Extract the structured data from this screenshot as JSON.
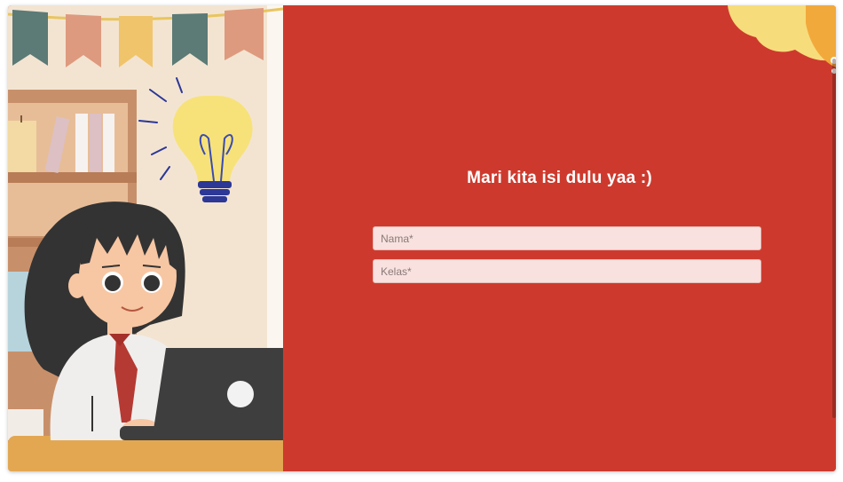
{
  "form": {
    "heading": "Mari kita isi dulu yaa :)",
    "name_placeholder": "Nama*",
    "class_placeholder": "Kelas*"
  },
  "colors": {
    "panel_red": "#cd3a2d",
    "field_bg": "#f8e1df",
    "wall": "#f3e4d2",
    "shelf": "#c8906a",
    "desk": "#e3a752",
    "bulb": "#f7e27a",
    "bulb_base": "#2c3796",
    "laptop": "#3e3e3e"
  },
  "icons": [
    "lightbulb-icon",
    "laptop-icon"
  ]
}
